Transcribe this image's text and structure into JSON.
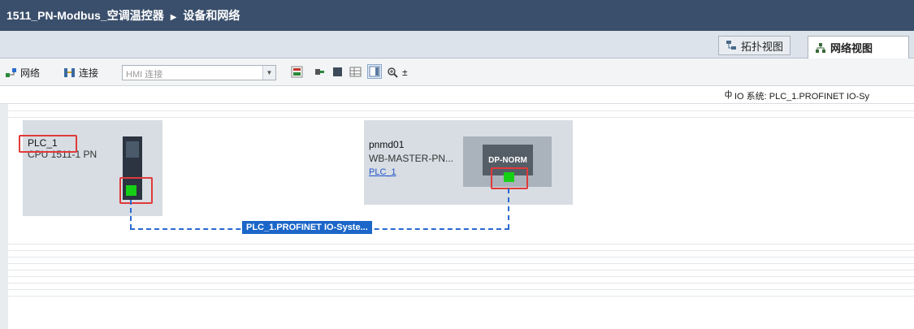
{
  "window": {
    "title_project": "1511_PN-Modbus_空调温控器",
    "title_arrow": "▶",
    "title_section": "设备和网络"
  },
  "view_tabs": [
    {
      "label": "拓扑视图",
      "icon": "topology-icon",
      "active": false
    },
    {
      "label": "网络视图",
      "icon": "network-view-icon",
      "active": true
    }
  ],
  "toolbar": {
    "network_label": "网络",
    "connection_label": "连接",
    "connection_select_value": "HMI 连接",
    "dropdown_arrow": "▼",
    "zoom_label": "±"
  },
  "io_system": {
    "pin": "ф",
    "label": "IO 系统: PLC_1.PROFINET IO-Sy"
  },
  "devices": [
    {
      "name": "PLC_1",
      "type": "CPU 1511-1 PN",
      "link": ""
    },
    {
      "name": "pnmd01",
      "type": "WB-MASTER-PN...",
      "link": "PLC_1",
      "module_label": "DP-NORM"
    }
  ],
  "network": {
    "label": "PLC_1.PROFINET IO-Syste..."
  },
  "colors": {
    "title_bg": "#3a4f6b",
    "device_bg": "#d7dde3",
    "port_green": "#16d016",
    "highlight_red": "#e03a3a",
    "network_blue": "#1b66c8"
  }
}
